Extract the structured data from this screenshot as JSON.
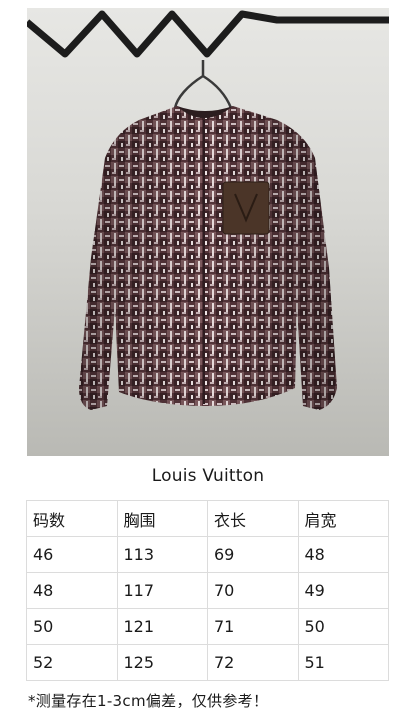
{
  "product": {
    "brand": "Louis Vuitton"
  },
  "size_table": {
    "headers": [
      "码数",
      "胸围",
      "衣长",
      "肩宽"
    ],
    "rows": [
      [
        "46",
        "113",
        "69",
        "48"
      ],
      [
        "48",
        "117",
        "70",
        "49"
      ],
      [
        "50",
        "121",
        "71",
        "50"
      ],
      [
        "52",
        "125",
        "72",
        "51"
      ]
    ]
  },
  "note": "*测量存在1-3cm偏差，仅供参考！",
  "colors": {
    "jacket_base": "#5b3a3e",
    "leather_pocket": "#4b3528",
    "rail": "#1c1c1c"
  }
}
